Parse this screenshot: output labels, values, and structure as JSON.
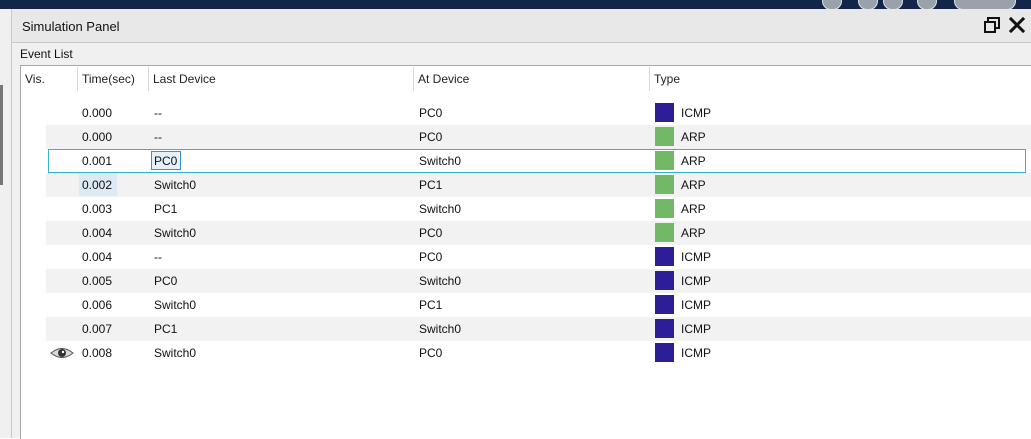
{
  "window": {
    "title": "Simulation Panel"
  },
  "section": {
    "label": "Event List"
  },
  "columns": {
    "vis": "Vis.",
    "time": "Time(sec)",
    "last_device": "Last Device",
    "at_device": "At Device",
    "type": "Type"
  },
  "colors": {
    "icmp": "#2b1e96",
    "arp": "#72b866",
    "selection": "#3ab0d0"
  },
  "icons": {
    "restore": "restore-window-icon",
    "close": "close-icon",
    "visible": "eye-icon"
  },
  "events": [
    {
      "time": "0.000",
      "last": "--",
      "at": "PC0",
      "type": "ICMP",
      "color": "#2b1e96"
    },
    {
      "time": "0.000",
      "last": "--",
      "at": "PC0",
      "type": "ARP",
      "color": "#72b866"
    },
    {
      "time": "0.001",
      "last": "PC0",
      "at": "Switch0",
      "type": "ARP",
      "color": "#72b866",
      "selected": true
    },
    {
      "time": "0.002",
      "last": "Switch0",
      "at": "PC1",
      "type": "ARP",
      "color": "#72b866"
    },
    {
      "time": "0.003",
      "last": "PC1",
      "at": "Switch0",
      "type": "ARP",
      "color": "#72b866"
    },
    {
      "time": "0.004",
      "last": "Switch0",
      "at": "PC0",
      "type": "ARP",
      "color": "#72b866"
    },
    {
      "time": "0.004",
      "last": "--",
      "at": "PC0",
      "type": "ICMP",
      "color": "#2b1e96"
    },
    {
      "time": "0.005",
      "last": "PC0",
      "at": "Switch0",
      "type": "ICMP",
      "color": "#2b1e96"
    },
    {
      "time": "0.006",
      "last": "Switch0",
      "at": "PC1",
      "type": "ICMP",
      "color": "#2b1e96"
    },
    {
      "time": "0.007",
      "last": "PC1",
      "at": "Switch0",
      "type": "ICMP",
      "color": "#2b1e96"
    },
    {
      "time": "0.008",
      "last": "Switch0",
      "at": "PC0",
      "type": "ICMP",
      "color": "#2b1e96",
      "visible": true
    }
  ]
}
